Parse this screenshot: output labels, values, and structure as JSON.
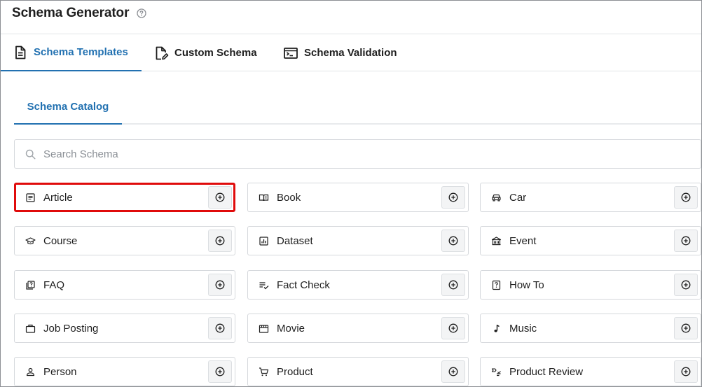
{
  "app": {
    "title": "Schema Generator",
    "help_icon": "help-circle-icon"
  },
  "tabs": [
    {
      "label": "Schema Templates",
      "icon": "document-icon",
      "active": true
    },
    {
      "label": "Custom Schema",
      "icon": "edit-document-icon",
      "active": false
    },
    {
      "label": "Schema Validation",
      "icon": "terminal-icon",
      "active": false
    }
  ],
  "subtabs": [
    {
      "label": "Schema Catalog",
      "active": true
    }
  ],
  "search": {
    "placeholder": "Search Schema",
    "value": "",
    "icon": "search-icon"
  },
  "catalog": [
    {
      "label": "Article",
      "icon": "article-icon",
      "highlighted": true
    },
    {
      "label": "Book",
      "icon": "book-icon"
    },
    {
      "label": "Car",
      "icon": "car-icon"
    },
    {
      "label": "Course",
      "icon": "graduation-cap-icon"
    },
    {
      "label": "Dataset",
      "icon": "dataset-icon"
    },
    {
      "label": "Event",
      "icon": "event-building-icon"
    },
    {
      "label": "FAQ",
      "icon": "faq-icon"
    },
    {
      "label": "Fact Check",
      "icon": "fact-check-icon"
    },
    {
      "label": "How To",
      "icon": "how-to-icon"
    },
    {
      "label": "Job Posting",
      "icon": "briefcase-icon"
    },
    {
      "label": "Movie",
      "icon": "movie-icon"
    },
    {
      "label": "Music",
      "icon": "music-note-icon"
    },
    {
      "label": "Person",
      "icon": "person-icon"
    },
    {
      "label": "Product",
      "icon": "cart-icon"
    },
    {
      "label": "Product Review",
      "icon": "review-icon"
    }
  ],
  "add_button_icon": "plus-circle-icon",
  "colors": {
    "accent": "#2271b1",
    "highlight": "#e00b0b",
    "border": "#d5d8dc"
  }
}
